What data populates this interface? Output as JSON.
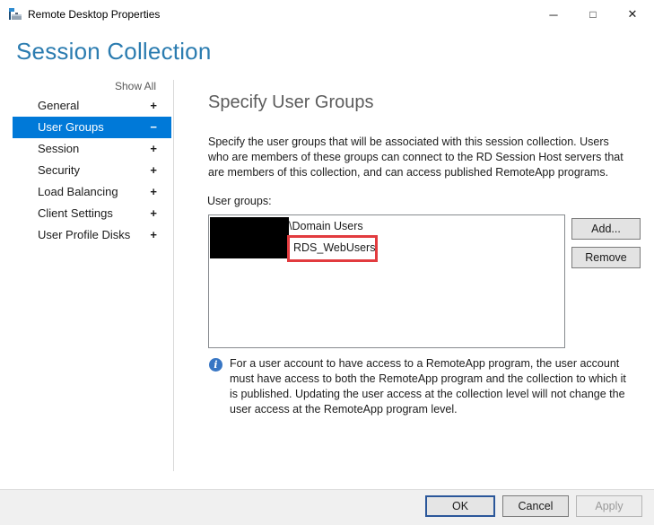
{
  "window": {
    "title": "Remote Desktop Properties",
    "icons": {
      "app": "server-manager-toolbox",
      "minimize": "─",
      "maximize": "□",
      "close": "✕"
    }
  },
  "page": {
    "title": "Session Collection"
  },
  "sidebar": {
    "show_all": "Show All",
    "items": [
      {
        "label": "General",
        "expander": "+",
        "selected": false
      },
      {
        "label": "User Groups",
        "expander": "−",
        "selected": true
      },
      {
        "label": "Session",
        "expander": "+",
        "selected": false
      },
      {
        "label": "Security",
        "expander": "+",
        "selected": false
      },
      {
        "label": "Load Balancing",
        "expander": "+",
        "selected": false
      },
      {
        "label": "Client Settings",
        "expander": "+",
        "selected": false
      },
      {
        "label": "User Profile Disks",
        "expander": "+",
        "selected": false
      }
    ]
  },
  "main": {
    "heading": "Specify User Groups",
    "description": "Specify the user groups that will be associated with this session collection. Users who are members of these groups can connect to the RD Session Host servers that are members of this collection, and can access published RemoteApp programs.",
    "user_groups_label": "User groups:",
    "groups": [
      {
        "name": "\\Domain Users",
        "prefix_redacted": true,
        "highlighted": false
      },
      {
        "name": "RDS_WebUsers",
        "prefix_redacted": true,
        "highlighted": true
      }
    ],
    "add_button": "Add...",
    "remove_button": "Remove",
    "info_icon_glyph": "i",
    "info_text": "For a user account to have access to a RemoteApp program, the user account must have access to both the RemoteApp program and the collection to which it is published. Updating the user access at the collection level will not change the user access at the RemoteApp program level."
  },
  "footer": {
    "ok": "OK",
    "cancel": "Cancel",
    "apply": "Apply"
  },
  "colors": {
    "selection_blue": "#0079d8",
    "heading_blue": "#2b7cb0",
    "annotation_red": "#e23b3f",
    "info_blue": "#3876c4",
    "footer_gray": "#f0f0f0"
  }
}
